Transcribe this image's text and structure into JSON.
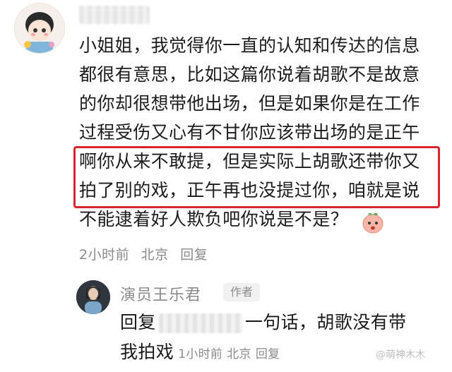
{
  "comment": {
    "lines": [
      "小姐姐，我觉得你一直的认知和传达的信息",
      "都很有意思，比如这篇你说着胡歌不是故意",
      "的你却很想带他出场，但是如果你是在工作",
      "过程受伤又心有不甘你应该带出场的是正午",
      "啊你从来不敢提，但是实际上胡歌还带你又",
      "拍了别的戏，正午再也没提过你，咱就是说",
      "不能逮着好人欺负吧你说是不是？"
    ],
    "time": "2小时前",
    "location": "北京",
    "reply_label": "回复",
    "emoji": "peach-emoji",
    "highlight_color": "#d7262e"
  },
  "reply": {
    "author_name": "演员王乐君",
    "author_badge": "作者",
    "text_prefix": "回复",
    "text_suffix": "一句话，胡歌没有带",
    "text_line2": "我拍戏",
    "time": "1小时前",
    "location": "北京",
    "reply_label": "回复"
  },
  "watermark": "@萌神木木"
}
